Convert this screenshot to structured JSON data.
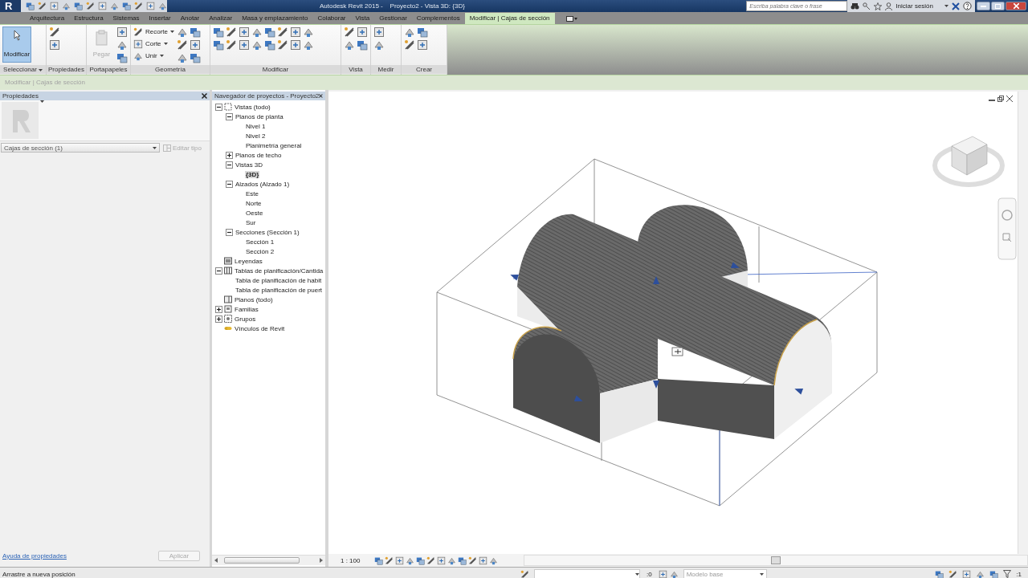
{
  "title_bar": {
    "app_button": "R",
    "title": "Autodesk Revit 2015 -    Proyecto2 - Vista 3D: {3D}",
    "search": {
      "placeholder": "Escriba palabra clave o frase"
    },
    "sign_in": "Iniciar sesión"
  },
  "ribbon_tabs": [
    {
      "label": "Arquitectura",
      "selected": false
    },
    {
      "label": "Estructura",
      "selected": false
    },
    {
      "label": "Sistemas",
      "selected": false
    },
    {
      "label": "Insertar",
      "selected": false
    },
    {
      "label": "Anotar",
      "selected": false
    },
    {
      "label": "Analizar",
      "selected": false
    },
    {
      "label": "Masa y emplazamiento",
      "selected": false
    },
    {
      "label": "Colaborar",
      "selected": false
    },
    {
      "label": "Vista",
      "selected": false
    },
    {
      "label": "Gestionar",
      "selected": false
    },
    {
      "label": "Complementos",
      "selected": false
    },
    {
      "label": "Modificar | Cajas de sección",
      "selected": true
    }
  ],
  "ribbon_panels": [
    {
      "label": "Seleccionar",
      "dropdown": true,
      "tools": [
        {
          "kind": "large",
          "label": "Modificar",
          "selected": true,
          "disabled": false
        }
      ]
    },
    {
      "label": "Propiedades"
    },
    {
      "label": "Portapapeles",
      "tools": [
        {
          "kind": "large",
          "label": "Pegar",
          "selected": false,
          "disabled": true
        }
      ]
    },
    {
      "label": "Geometría",
      "tools": [
        {
          "kind": "small",
          "label": "Recorte"
        },
        {
          "kind": "small",
          "label": "Corte"
        },
        {
          "kind": "small",
          "label": "Unir"
        }
      ]
    },
    {
      "label": "Modificar"
    },
    {
      "label": "Vista"
    },
    {
      "label": "Medir"
    },
    {
      "label": "Crear"
    }
  ],
  "options_bar": {
    "context": "Modificar | Cajas de sección"
  },
  "properties": {
    "title": "Propiedades",
    "type_selector": "Cajas de sección (1)",
    "edit_type": {
      "label": "Editar tipo",
      "disabled": true
    },
    "help_link": "Ayuda de propiedades",
    "apply": {
      "label": "Aplicar",
      "disabled": true
    }
  },
  "project_browser": {
    "title": "Navegador de proyectos - Proyecto2",
    "tree": [
      {
        "label": "Vistas (todo)",
        "kind": "views",
        "expanded": true,
        "selected": false,
        "children": [
          {
            "label": "Planos de planta",
            "expanded": true,
            "selected": false,
            "children": [
              {
                "label": "Nivel 1",
                "selected": false
              },
              {
                "label": "Nivel 2",
                "selected": false
              },
              {
                "label": "Planimetría general",
                "selected": false
              }
            ]
          },
          {
            "label": "Planos de techo",
            "expanded": false,
            "selected": false
          },
          {
            "label": "Vistas 3D",
            "expanded": true,
            "selected": false,
            "children": [
              {
                "label": "{3D}",
                "selected": true
              }
            ]
          },
          {
            "label": "Alzados (Alzado 1)",
            "expanded": true,
            "selected": false,
            "children": [
              {
                "label": "Este",
                "selected": false
              },
              {
                "label": "Norte",
                "selected": false
              },
              {
                "label": "Oeste",
                "selected": false
              },
              {
                "label": "Sur",
                "selected": false
              }
            ]
          },
          {
            "label": "Secciones (Sección 1)",
            "expanded": true,
            "selected": false,
            "children": [
              {
                "label": "Sección 1",
                "selected": false
              },
              {
                "label": "Sección 2",
                "selected": false
              }
            ]
          }
        ]
      },
      {
        "label": "Leyendas",
        "kind": "legend",
        "selected": false
      },
      {
        "label": "Tablas de planificación/Cantida",
        "kind": "schedule",
        "expanded": true,
        "selected": false,
        "children": [
          {
            "label": "Tabla de planificación de habit",
            "selected": false
          },
          {
            "label": "Tabla de planificación de puert",
            "selected": false
          }
        ]
      },
      {
        "label": "Planos (todo)",
        "kind": "sheet",
        "selected": false
      },
      {
        "label": "Familias",
        "kind": "family",
        "expanded": false,
        "selected": false
      },
      {
        "label": "Grupos",
        "kind": "group",
        "expanded": false,
        "selected": false
      },
      {
        "label": "Vínculos de Revit",
        "kind": "link",
        "selected": false
      }
    ]
  },
  "view_control_bar": {
    "scale": "1 : 100"
  },
  "status_bar": {
    "message": "Arrastre a nueva posición",
    "editable_count": ":0",
    "model_selector": "Modelo base",
    "filter_count": ":1"
  }
}
